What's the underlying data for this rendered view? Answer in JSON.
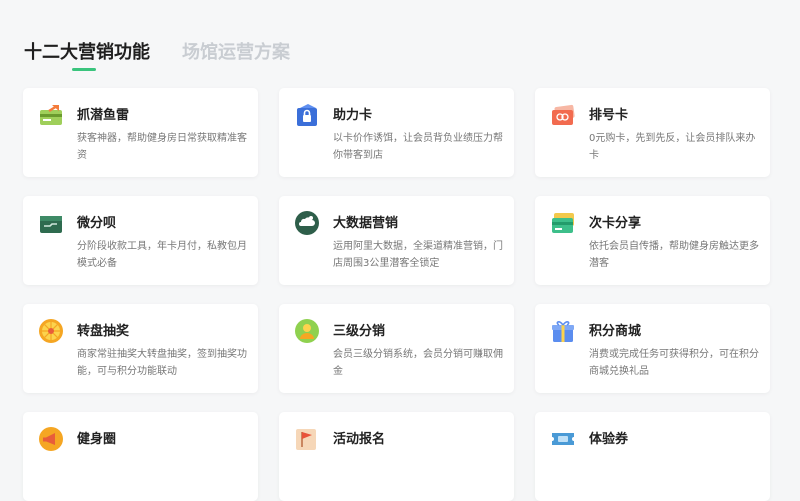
{
  "tabs": [
    {
      "label": "十二大营销功能",
      "active": true
    },
    {
      "label": "场馆运营方案",
      "active": false
    }
  ],
  "colors": {
    "accent": "#3ac47d",
    "inactive_tab": "#c9cdd2"
  },
  "cards": [
    {
      "title": "抓潜鱼雷",
      "desc": "获客神器，帮助健身房日常获取精准客资",
      "icon": "lead-card-icon"
    },
    {
      "title": "助力卡",
      "desc": "以卡价作诱饵，让会员背负业绩压力帮你带客到店",
      "icon": "lock-card-icon"
    },
    {
      "title": "排号卡",
      "desc": "0元购卡，先到先反，让会员排队来办卡",
      "icon": "queue-card-icon"
    },
    {
      "title": "微分呗",
      "desc": "分阶段收款工具，年卡月付，私教包月模式必备",
      "icon": "wallet-icon"
    },
    {
      "title": "大数据营销",
      "desc": "运用阿里大数据，全渠道精准营销，门店周围3公里潜客全锁定",
      "icon": "cloud-data-icon"
    },
    {
      "title": "次卡分享",
      "desc": "依托会员自传播，帮助健身房触达更多潜客",
      "icon": "share-card-icon"
    },
    {
      "title": "转盘抽奖",
      "desc": "商家常驻抽奖大转盘抽奖，签到抽奖功能，可与积分功能联动",
      "icon": "wheel-icon"
    },
    {
      "title": "三级分销",
      "desc": "会员三级分销系统，会员分销可赚取佣金",
      "icon": "distribution-icon"
    },
    {
      "title": "积分商城",
      "desc": "消费或完成任务可获得积分，可在积分商城兑换礼品",
      "icon": "gift-icon"
    },
    {
      "title": "健身圈",
      "desc": "",
      "icon": "megaphone-icon"
    },
    {
      "title": "活动报名",
      "desc": "",
      "icon": "flag-icon"
    },
    {
      "title": "体验券",
      "desc": "",
      "icon": "ticket-icon"
    }
  ]
}
